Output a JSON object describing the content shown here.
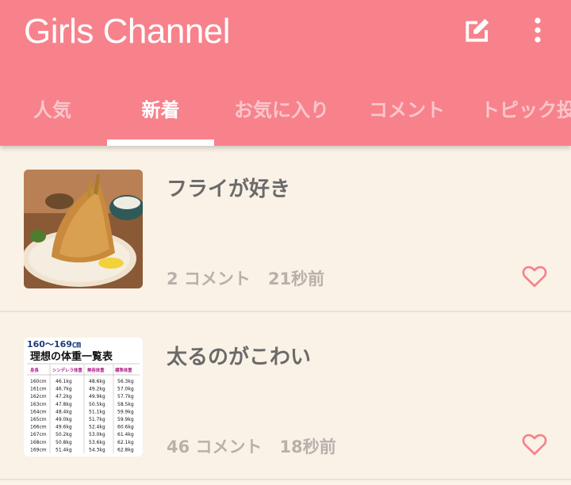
{
  "app": {
    "title": "Girls Channel"
  },
  "actions": {
    "compose_icon": "compose-icon",
    "more_icon": "more-vert-icon"
  },
  "tabs": [
    {
      "label": "人気"
    },
    {
      "label": "新着"
    },
    {
      "label": "お気に入り"
    },
    {
      "label": "コメント"
    },
    {
      "label": "トピック投稿"
    }
  ],
  "active_tab": "新着",
  "topics": [
    {
      "title": "フライが好き",
      "comments": "2 コメント",
      "time": "21秒前",
      "thumbnail": "fried-fish-photo"
    },
    {
      "title": "太るのがこわい",
      "comments": "46 コメント",
      "time": "18秒前",
      "thumbnail": "weight-table-image",
      "thumb_text": {
        "range": "160〜169㎝",
        "heading": "理想の体重一覧表",
        "columns": [
          "身長",
          "シンデレラ体重",
          "美容体重",
          "標準体重"
        ],
        "rows": [
          [
            "160cm",
            "46.1kg",
            "48.6kg",
            "56.3kg"
          ],
          [
            "161cm",
            "46.7kg",
            "49.2kg",
            "57.0kg"
          ],
          [
            "162cm",
            "47.2kg",
            "49.9kg",
            "57.7kg"
          ],
          [
            "163cm",
            "47.8kg",
            "50.5kg",
            "58.5kg"
          ],
          [
            "164cm",
            "48.4kg",
            "51.1kg",
            "59.9kg"
          ],
          [
            "165cm",
            "49.0kg",
            "51.7kg",
            "59.9kg"
          ],
          [
            "166cm",
            "49.6kg",
            "52.4kg",
            "60.6kg"
          ],
          [
            "167cm",
            "50.2kg",
            "53.0kg",
            "61.4kg"
          ],
          [
            "168cm",
            "50.8kg",
            "53.6kg",
            "62.1kg"
          ],
          [
            "169cm",
            "51.4kg",
            "54.3kg",
            "62.8kg"
          ]
        ]
      }
    }
  ],
  "colors": {
    "brand": "#f7828c",
    "background": "#faf2e6",
    "heart": "#f7828c"
  }
}
